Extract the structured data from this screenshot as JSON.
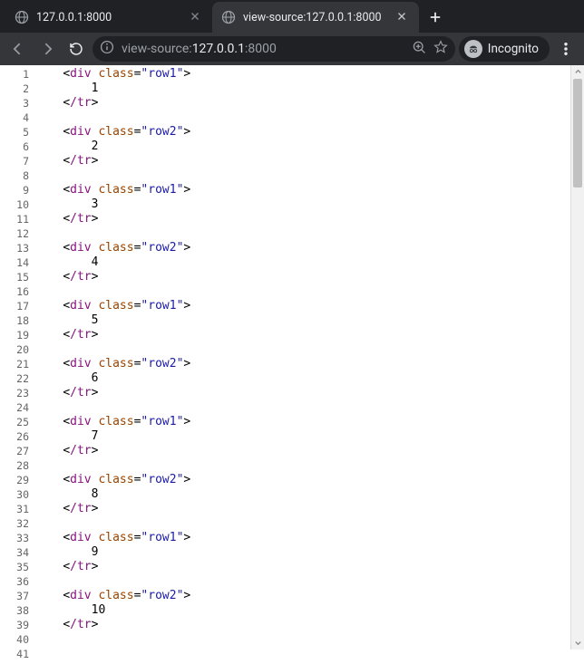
{
  "tabs": [
    {
      "title": "127.0.0.1:8000",
      "active": false
    },
    {
      "title": "view-source:127.0.0.1:8000",
      "active": true
    }
  ],
  "toolbar": {
    "url_scheme": "view-source:",
    "url_origin": "127.0.0.1",
    "url_port": ":8000"
  },
  "incognito_label": "Incognito",
  "source": {
    "line_count": 41,
    "blocks": [
      {
        "class": "row1",
        "text": "1"
      },
      {
        "class": "row2",
        "text": "2"
      },
      {
        "class": "row1",
        "text": "3"
      },
      {
        "class": "row2",
        "text": "4"
      },
      {
        "class": "row1",
        "text": "5"
      },
      {
        "class": "row2",
        "text": "6"
      },
      {
        "class": "row1",
        "text": "7"
      },
      {
        "class": "row2",
        "text": "8"
      },
      {
        "class": "row1",
        "text": "9"
      },
      {
        "class": "row2",
        "text": "10"
      }
    ],
    "indent_open": "    ",
    "indent_text": "        ",
    "open_tag": "div",
    "attr_name": "class",
    "close_tag": "/tr"
  }
}
